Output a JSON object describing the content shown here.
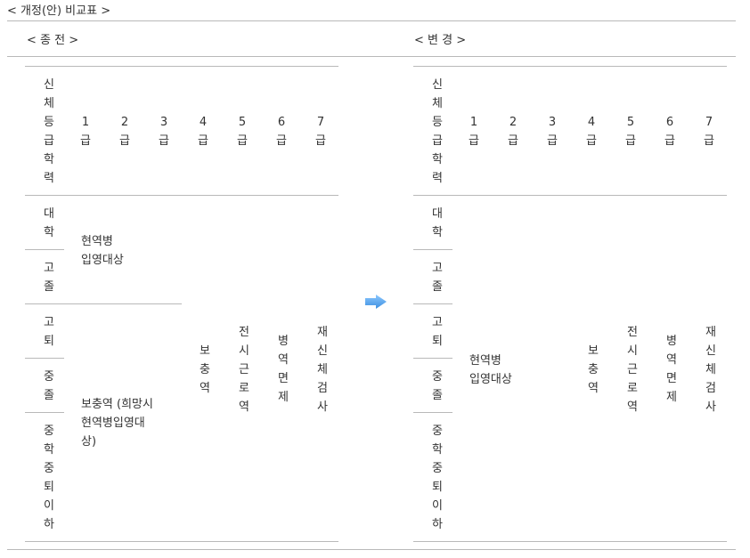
{
  "title": "< 개정(안) 비교표 >",
  "panels": [
    {
      "heading": "< 종 전 >",
      "corner": "신\n체\n등\n급\n학\n력",
      "grades": [
        "1\n급",
        "2\n급",
        "3\n급",
        "4\n급",
        "5\n급",
        "6\n급",
        "7\n급"
      ],
      "education": [
        "대\n학",
        "고\n졸",
        "고\n퇴",
        "중\n졸",
        "중\n학\n중\n퇴\n이\n하"
      ],
      "top_group": "현역병\n입영대상",
      "bottom_group": "보충역 (희망시\n현역병입영대\n상)",
      "col_4": "보\n충\n역",
      "col_5": "전\n시\n근\n로\n역",
      "col_6": "병\n역\n면\n제",
      "col_7": "재\n신\n체\n검\n사"
    },
    {
      "heading": "< 변 경 >",
      "corner": "신\n체\n등\n급\n학\n력",
      "grades": [
        "1\n급",
        "2\n급",
        "3\n급",
        "4\n급",
        "5\n급",
        "6\n급",
        "7\n급"
      ],
      "education": [
        "대\n학",
        "고\n졸",
        "고\n퇴",
        "중\n졸",
        "중\n학\n중\n퇴\n이\n하"
      ],
      "merged_group": "현역병\n입영대상",
      "col_4": "보\n충\n역",
      "col_5": "전\n시\n근\n로\n역",
      "col_6": "병\n역\n면\n제",
      "col_7": "재\n신\n체\n검\n사"
    }
  ],
  "arrow_color": "#5aa5f0"
}
